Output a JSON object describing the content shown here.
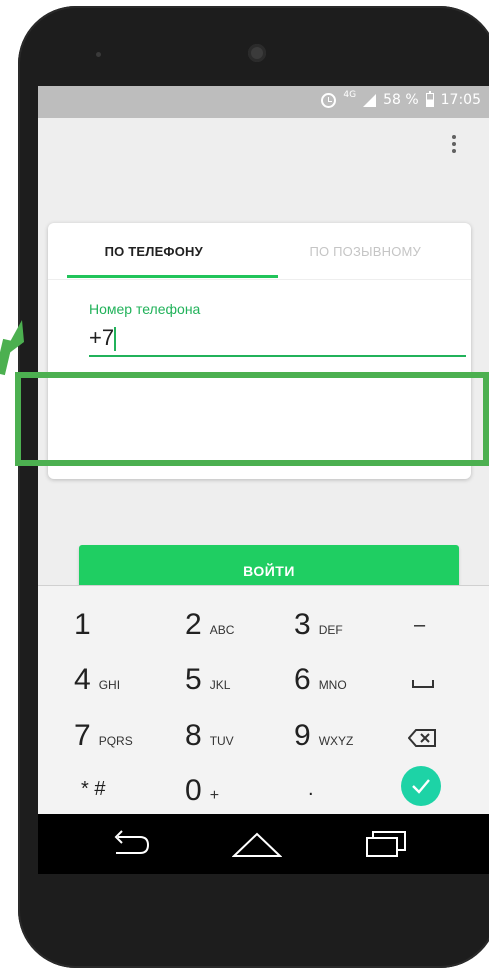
{
  "status_bar": {
    "network": "4G",
    "battery": "58 %",
    "time": "17:05",
    "icons": [
      "alarm-icon",
      "signal-icon",
      "battery-icon"
    ]
  },
  "menu": {
    "icon": "more-vert-icon"
  },
  "tabs": [
    {
      "label": "ПО ТЕЛЕФОНУ",
      "active": true
    },
    {
      "label": "ПО ПОЗЫВНОМУ",
      "active": false
    }
  ],
  "phone_field": {
    "label": "Номер телефона",
    "value": "+7"
  },
  "login_button": {
    "label": "ВОЙТИ"
  },
  "keypad": {
    "keys": [
      {
        "num": "1",
        "letters": ""
      },
      {
        "num": "2",
        "letters": "ABC"
      },
      {
        "num": "3",
        "letters": "DEF"
      },
      {
        "num": "4",
        "letters": "GHI"
      },
      {
        "num": "5",
        "letters": "JKL"
      },
      {
        "num": "6",
        "letters": "MNO"
      },
      {
        "num": "7",
        "letters": "PQRS"
      },
      {
        "num": "8",
        "letters": "TUV"
      },
      {
        "num": "9",
        "letters": "WXYZ"
      },
      {
        "num": "* #",
        "letters": ""
      },
      {
        "num": "0",
        "letters": "+"
      },
      {
        "num": ".",
        "letters": ""
      }
    ],
    "minus": "–",
    "icons": [
      "space-icon",
      "backspace-icon",
      "check-icon"
    ]
  },
  "nav": {
    "icons": [
      "back-icon",
      "home-icon",
      "recents-icon"
    ]
  },
  "colors": {
    "accent": "#21c45a",
    "button": "#1fce62",
    "done": "#1dd3a6",
    "annotation": "#4cb050"
  }
}
